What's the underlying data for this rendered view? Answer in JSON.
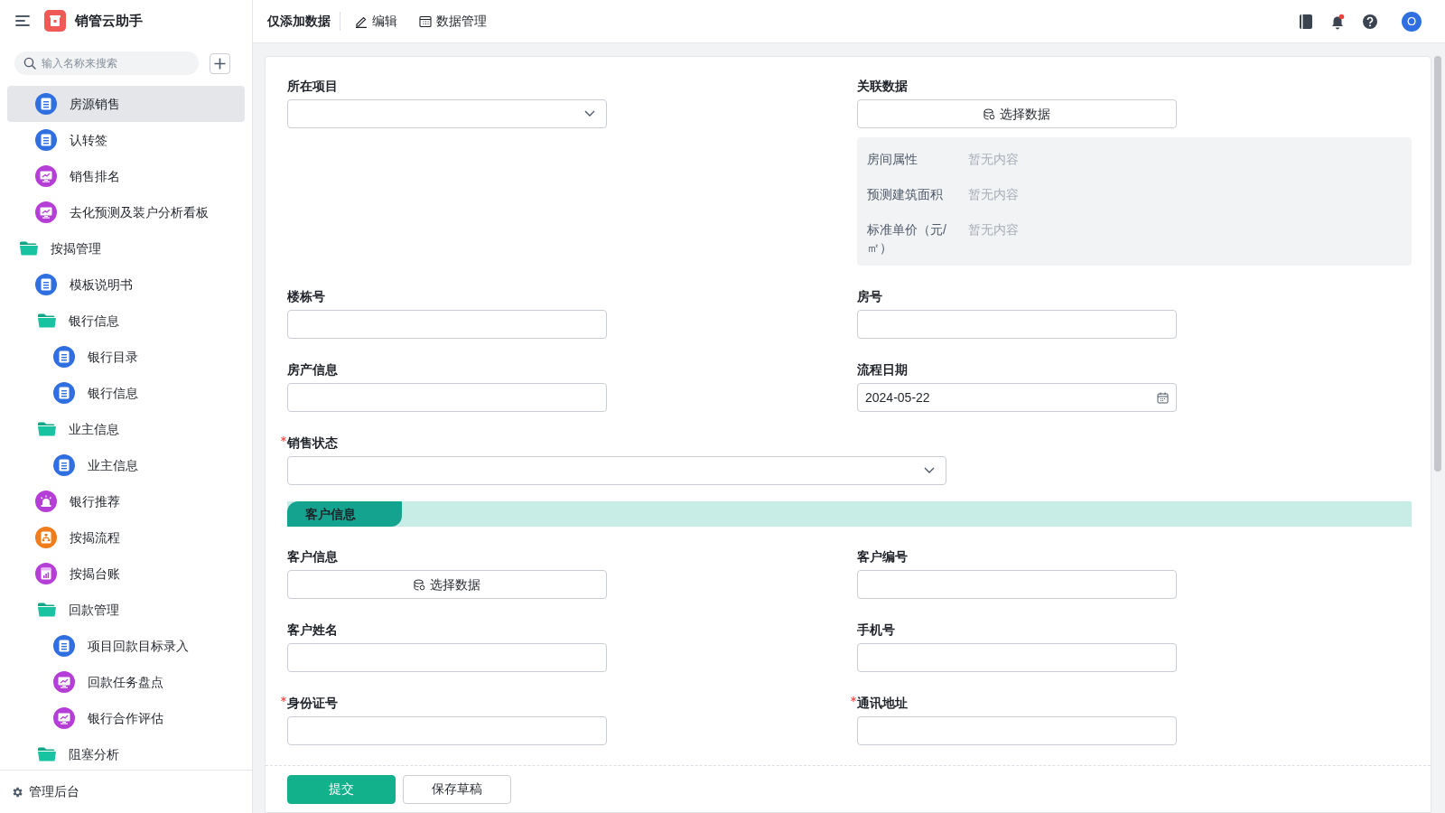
{
  "app": {
    "title": "销管云助手"
  },
  "sidebar": {
    "search": {
      "placeholder": "输入名称来搜索"
    },
    "items": [
      {
        "label": "房源销售",
        "kind": "form",
        "selected": true
      },
      {
        "label": "认转签",
        "kind": "form",
        "selected": false
      },
      {
        "label": "销售排名",
        "kind": "dashboard",
        "selected": false
      },
      {
        "label": "去化预测及装户分析看板",
        "kind": "dashboard",
        "selected": false
      },
      {
        "label": "按揭管理",
        "kind": "folder",
        "selected": false,
        "children": [
          {
            "label": "模板说明书",
            "kind": "form",
            "selected": false
          },
          {
            "label": "银行信息",
            "kind": "folder",
            "selected": false,
            "children": [
              {
                "label": "银行目录",
                "kind": "form",
                "selected": false
              },
              {
                "label": "银行信息",
                "kind": "form",
                "selected": false
              }
            ]
          },
          {
            "label": "业主信息",
            "kind": "folder",
            "selected": false,
            "children": [
              {
                "label": "业主信息",
                "kind": "form",
                "selected": false
              }
            ]
          },
          {
            "label": "银行推荐",
            "kind": "alert",
            "selected": false
          },
          {
            "label": "按揭流程",
            "kind": "flow",
            "selected": false
          },
          {
            "label": "按揭台账",
            "kind": "report",
            "selected": false
          },
          {
            "label": "回款管理",
            "kind": "folder",
            "selected": false,
            "children": [
              {
                "label": "项目回款目标录入",
                "kind": "form",
                "selected": false
              },
              {
                "label": "回款任务盘点",
                "kind": "dashboard",
                "selected": false
              },
              {
                "label": "银行合作评估",
                "kind": "dashboard",
                "selected": false
              }
            ]
          },
          {
            "label": "阻塞分析",
            "kind": "folder",
            "selected": false
          }
        ]
      }
    ],
    "footer": "管理后台"
  },
  "header": {
    "title": "仅添加数据",
    "actions": [
      {
        "label": "编辑",
        "kind": "edit"
      },
      {
        "label": "数据管理",
        "kind": "table"
      }
    ],
    "avatar": "O"
  },
  "form": {
    "items": [
      {
        "kind": "row",
        "fields": [
          {
            "label": "所在项目",
            "kind": "select",
            "required": false
          },
          {
            "label": "关联数据",
            "kind": "linked",
            "required": false,
            "button": "选择数据",
            "details": [
              {
                "label": "房间属性",
                "value": "暂无内容"
              },
              {
                "label": "预测建筑面积",
                "value": "暂无内容"
              },
              {
                "label": "标准单价（元/㎡）",
                "value": "暂无内容"
              }
            ]
          }
        ]
      },
      {
        "kind": "row",
        "fields": [
          {
            "label": "楼栋号",
            "kind": "text",
            "required": false
          },
          {
            "label": "房号",
            "kind": "text",
            "required": false
          }
        ]
      },
      {
        "kind": "row",
        "fields": [
          {
            "label": "房产信息",
            "kind": "text",
            "required": false
          },
          {
            "label": "流程日期",
            "kind": "date",
            "required": false,
            "value": "2024-05-22"
          }
        ]
      },
      {
        "kind": "row",
        "fields": [
          {
            "label": "销售状态",
            "kind": "select",
            "required": true
          }
        ]
      },
      {
        "kind": "section",
        "title": "客户信息"
      },
      {
        "kind": "row",
        "fields": [
          {
            "label": "客户信息",
            "kind": "picker",
            "required": false,
            "button": "选择数据"
          },
          {
            "label": "客户编号",
            "kind": "text",
            "required": false
          }
        ]
      },
      {
        "kind": "row",
        "fields": [
          {
            "label": "客户姓名",
            "kind": "text",
            "required": false
          },
          {
            "label": "手机号",
            "kind": "text",
            "required": false
          }
        ]
      },
      {
        "kind": "row",
        "fields": [
          {
            "label": "身份证号",
            "kind": "text",
            "required": true
          },
          {
            "label": "通讯地址",
            "kind": "text",
            "required": true
          }
        ]
      }
    ],
    "buttons": [
      {
        "label": "提交",
        "kind": "primary"
      },
      {
        "label": "保存草稿",
        "kind": "default"
      }
    ]
  }
}
